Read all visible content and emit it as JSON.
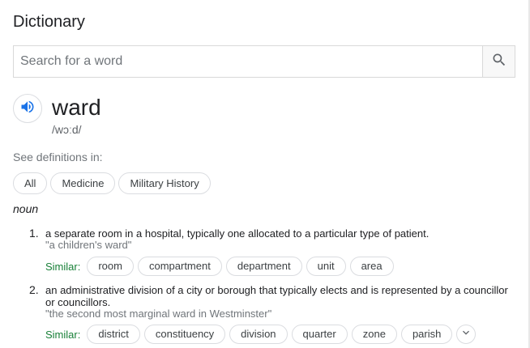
{
  "title": "Dictionary",
  "search": {
    "placeholder": "Search for a word",
    "value": ""
  },
  "entry": {
    "word": "ward",
    "phonetic": "/wɔːd/"
  },
  "see_definitions_label": "See definitions in:",
  "categories": [
    "All",
    "Medicine",
    "Military History"
  ],
  "part_of_speech": "noun",
  "similar_label": "Similar:",
  "definitions": [
    {
      "number": "1.",
      "text": "a separate room in a hospital, typically one allocated to a particular type of patient.",
      "example": "\"a children's ward\"",
      "similar": [
        "room",
        "compartment",
        "department",
        "unit",
        "area"
      ]
    },
    {
      "number": "2.",
      "text": "an administrative division of a city or borough that typically elects and is represented by a councillor or councillors.",
      "example": "\"the second most marginal ward in Westminster\"",
      "similar": [
        "district",
        "constituency",
        "division",
        "quarter",
        "zone",
        "parish"
      ]
    }
  ],
  "icons": {
    "search": "search-icon",
    "speaker": "speaker-icon",
    "expand": "chevron-down-icon"
  },
  "colors": {
    "accent": "#1a73e8",
    "similar_label": "#188038"
  }
}
